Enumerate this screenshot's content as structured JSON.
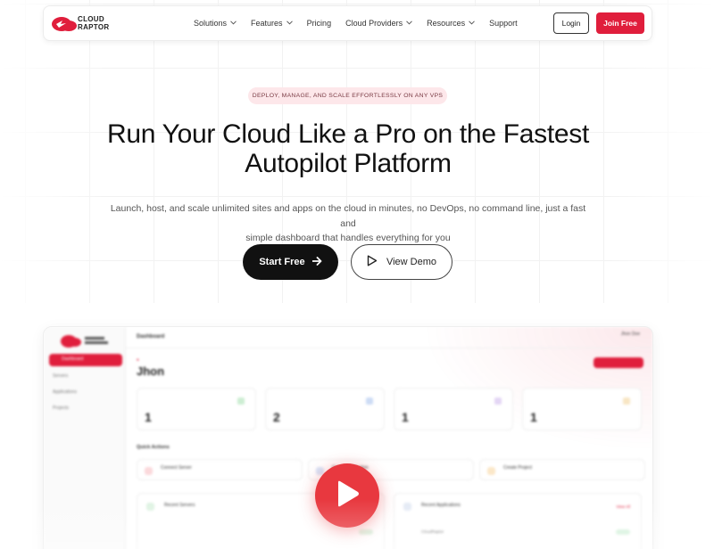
{
  "brand": {
    "line1": "CLOUD",
    "line2": "RAPTOR",
    "accent": "#e01e3c"
  },
  "nav": {
    "items": [
      {
        "label": "Solutions",
        "has_dropdown": true
      },
      {
        "label": "Features",
        "has_dropdown": true
      },
      {
        "label": "Pricing",
        "has_dropdown": false
      },
      {
        "label": "Cloud Providers",
        "has_dropdown": true
      },
      {
        "label": "Resources",
        "has_dropdown": true
      },
      {
        "label": "Support",
        "has_dropdown": false
      }
    ],
    "login_label": "Login",
    "join_label": "Join Free"
  },
  "hero": {
    "pill": "DEPLOY, MANAGE, AND SCALE EFFORTLESSLY ON ANY VPS",
    "headline_line1": "Run Your Cloud Like a Pro on the Fastest",
    "headline_line2": "Autopilot Platform",
    "subtext_line1": "Launch, host, and scale unlimited sites and apps on the cloud in minutes, no DevOps, no command line, just a fast and",
    "subtext_line2": "simple dashboard that handles everything for you",
    "start_label": "Start Free",
    "demo_label": "View Demo"
  },
  "preview": {
    "sidebar": [
      "Dashboard",
      "Servers",
      "Applications",
      "Projects"
    ],
    "topbar_title": "Dashboard",
    "user_name": "Jhon Doe",
    "greeting_name": "Jhon",
    "stats": [
      {
        "value": "1",
        "color": "#cdeed3"
      },
      {
        "value": "2",
        "color": "#cddcf5"
      },
      {
        "value": "1",
        "color": "#e4d6f5"
      },
      {
        "value": "1",
        "color": "#f8e6c4"
      }
    ],
    "quick_actions_title": "Quick Actions",
    "quick_actions": [
      {
        "label": "Connect Server",
        "color": "#fbd9dc"
      },
      {
        "label": "Create Application",
        "color": "#d7e4f8"
      },
      {
        "label": "Create Project",
        "color": "#fbe7c8"
      }
    ],
    "recent_servers_title": "Recent Servers",
    "recent_apps_title": "Recent Applications",
    "view_all": "View All",
    "app_row": "CloudRaptor"
  }
}
